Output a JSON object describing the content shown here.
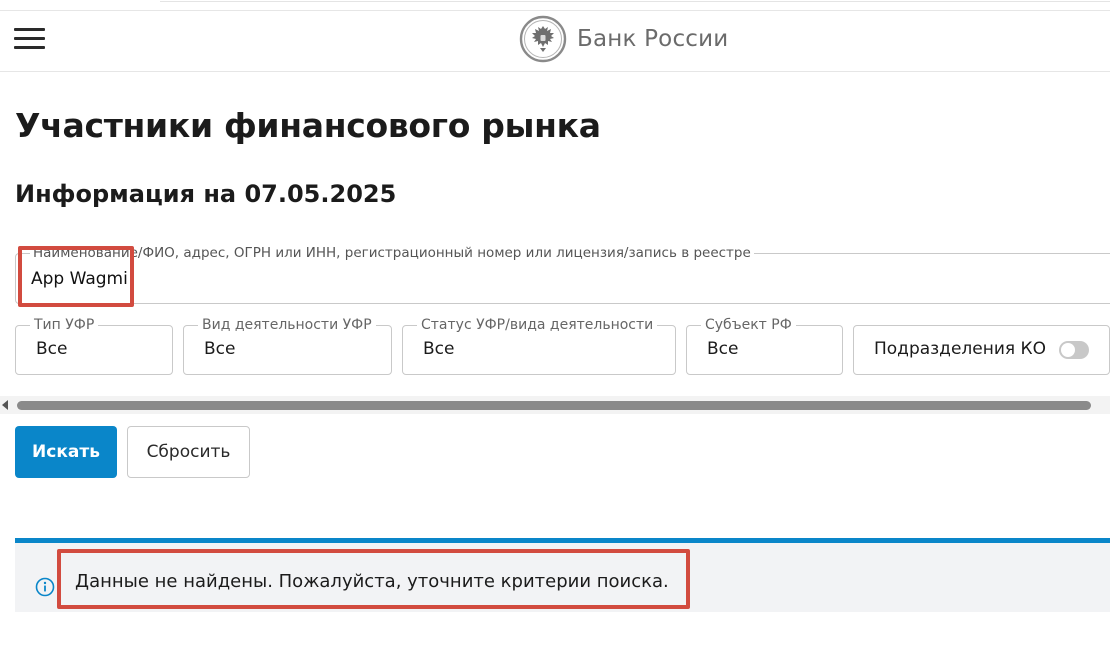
{
  "header": {
    "brand": "Банк России",
    "menu_icon": "hamburger-menu-icon",
    "logo_icon": "double-headed-eagle-emblem-icon"
  },
  "page": {
    "title": "Участники финансового рынка",
    "subtitle": "Информация на 07.05.2025"
  },
  "search": {
    "label": "Наименование/ФИО, адрес, ОГРН или ИНН, регистрационный номер или лицензия/запись в реестре",
    "value": "App Wagmi"
  },
  "filters": [
    {
      "label": "Тип УФР",
      "value": "Все"
    },
    {
      "label": "Вид деятельности УФР",
      "value": "Все"
    },
    {
      "label": "Статус УФР/вида деятельности",
      "value": "Все"
    },
    {
      "label": "Субъект РФ",
      "value": "Все"
    }
  ],
  "toggle": {
    "label": "Подразделения КО",
    "state": "off"
  },
  "buttons": {
    "search_label": "Искать",
    "reset_label": "Сбросить"
  },
  "alert": {
    "icon": "info-circle-icon",
    "message": "Данные не найдены. Пожалуйста, уточните критерии поиска."
  },
  "colors": {
    "primary": "#0a86c9",
    "highlight": "#d24b3f",
    "alert_bg": "#f2f3f5"
  }
}
